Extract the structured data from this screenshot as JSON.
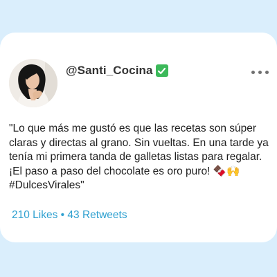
{
  "post": {
    "handle": "@Santi_Cocina",
    "verified_icon": "check-mark-button-icon",
    "more_icon": "more-horizontal-icon",
    "text": "\"Lo que más me gustó es que las recetas son súper claras y directas al grano. Sin vueltas. En una tarde ya tenía mi primera tanda de galletas listas para regalar. ¡El paso a paso del chocolate es oro puro! 🍫🙌 #DulcesVirales\"",
    "likes": "210 Likes",
    "separator": "•",
    "retweets": "43 Retweets"
  },
  "colors": {
    "background": "#daeefc",
    "card": "#ffffff",
    "verified": "#3cb95a",
    "stats": "#2ea0d0"
  }
}
